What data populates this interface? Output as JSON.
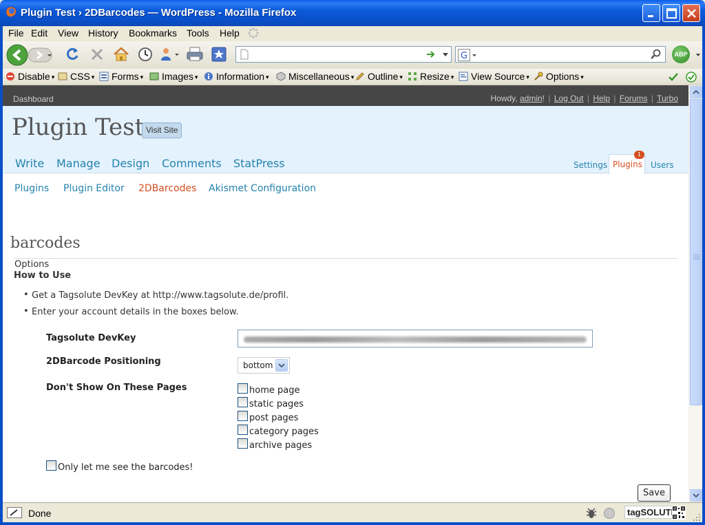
{
  "window": {
    "title": "Plugin Test › 2DBarcodes — WordPress - Mozilla Firefox"
  },
  "menubar": {
    "items": [
      "File",
      "Edit",
      "View",
      "History",
      "Bookmarks",
      "Tools",
      "Help"
    ]
  },
  "navbar": {
    "url": "",
    "search_value": "",
    "abp_label": "ABP"
  },
  "devbar": {
    "items": [
      "Disable",
      "CSS",
      "Forms",
      "Images",
      "Information",
      "Miscellaneous",
      "Outline",
      "Resize",
      "View Source",
      "Options"
    ]
  },
  "wp_admin_bar": {
    "dashboard": "Dashboard",
    "howdy_prefix": "Howdy,",
    "user": "admin",
    "howdy_suffix": "!",
    "links": [
      "Log Out",
      "Help",
      "Forums",
      "Turbo"
    ]
  },
  "header": {
    "blog_title": "Plugin Test",
    "visit_site": "Visit Site",
    "main_tabs": [
      "Write",
      "Manage",
      "Design",
      "Comments",
      "StatPress"
    ],
    "side_tabs": [
      "Settings",
      "Plugins",
      "Users"
    ],
    "plugins_update_count": "1"
  },
  "submenu": {
    "items": [
      "Plugins",
      "Plugin Editor",
      "2DBarcodes",
      "Akismet Configuration"
    ],
    "current": "2DBarcodes"
  },
  "content": {
    "heading": "barcodes",
    "options_label": "Options",
    "howto_title": "How to Use",
    "instructions": [
      "Get a Tagsolute DevKey at http://www.tagsolute.de/profil.",
      "Enter your account details in the boxes below."
    ],
    "devkey_label": "Tagsolute DevKey",
    "positioning_label": "2DBarcode Positioning",
    "positioning_value": "bottom",
    "hide_pages_label": "Don't Show On These Pages",
    "page_options": [
      "home page",
      "static pages",
      "post pages",
      "category pages",
      "archive pages"
    ],
    "only_me_label": "Only let me see the barcodes!",
    "save_label": "Save"
  },
  "statusbar": {
    "status": "Done",
    "tag_logo": "tagSOLUTE"
  },
  "colors": {
    "wp_link": "#2583AD",
    "wp_current": "#D54E21",
    "title_bar": "#0A5FE8"
  }
}
